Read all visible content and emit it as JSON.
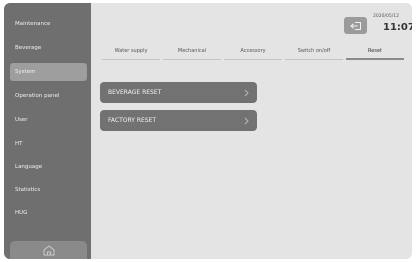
{
  "sidebar": {
    "items": [
      {
        "label": "Maintenance"
      },
      {
        "label": "Beverage"
      },
      {
        "label": "System"
      },
      {
        "label": "Operation panel"
      },
      {
        "label": "User"
      },
      {
        "label": "HT"
      },
      {
        "label": "Language"
      },
      {
        "label": "Statistics"
      },
      {
        "label": "HUG"
      }
    ],
    "active_index": 2,
    "home_icon": "home-icon"
  },
  "header": {
    "back_icon": "back-arrow-icon",
    "date": "2020/05/12",
    "time": "11:07"
  },
  "tabs": [
    {
      "label": "Water supply"
    },
    {
      "label": "Mechanical"
    },
    {
      "label": "Accessory"
    },
    {
      "label": "Switch on/off"
    },
    {
      "label": "Reset"
    }
  ],
  "active_tab": 4,
  "actions": [
    {
      "label": "BEVERAGE RESET"
    },
    {
      "label": "FACTORY RESET"
    }
  ],
  "colors": {
    "sidebar": "#6f6f6f",
    "sidebar_active": "#9e9e9e",
    "content_bg": "#e4e4e4",
    "button": "#727272"
  }
}
